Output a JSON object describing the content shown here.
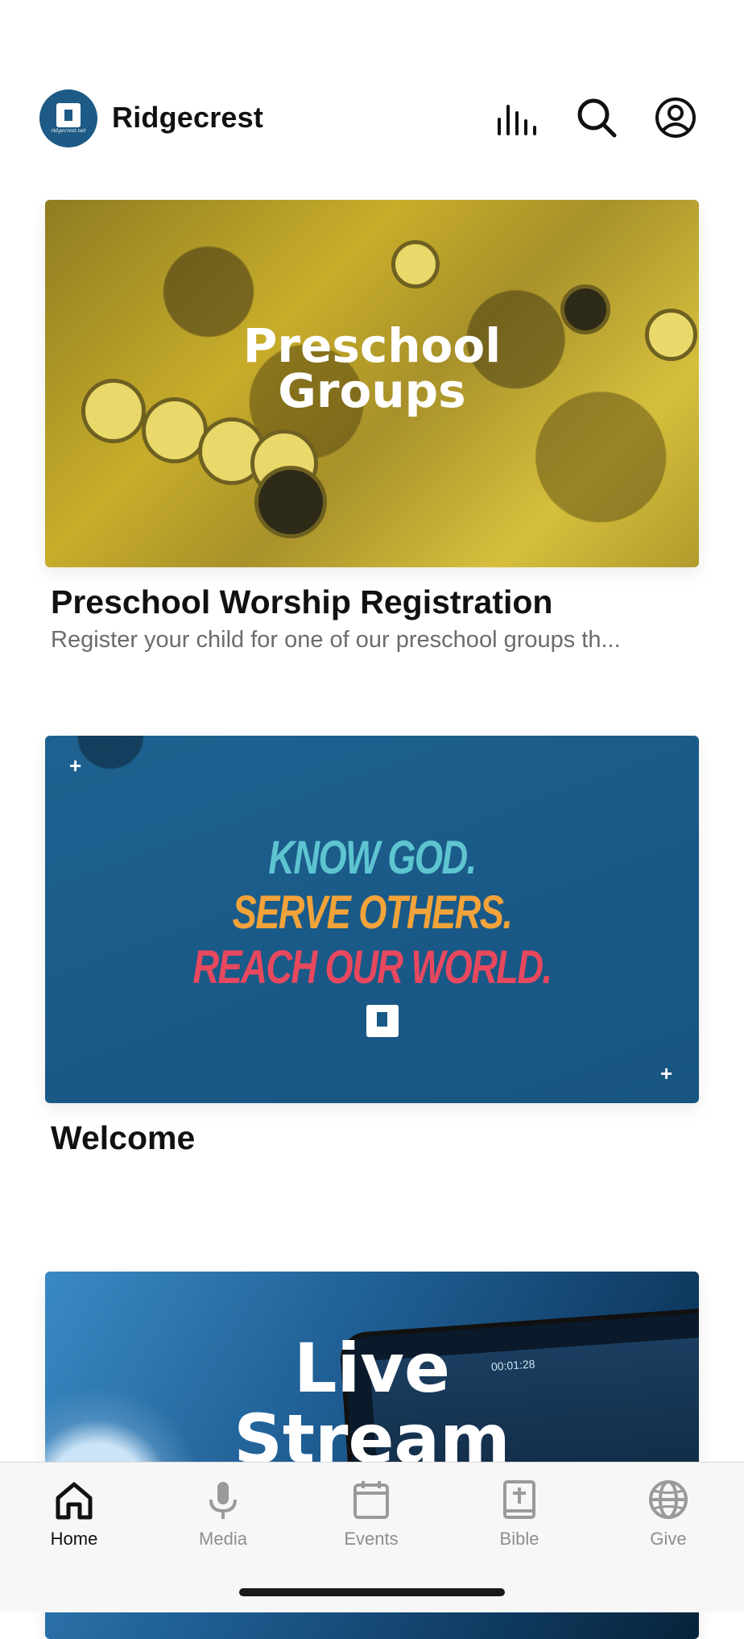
{
  "header": {
    "app_title": "Ridgecrest",
    "logo_text": "ridgecrest.net",
    "icons": [
      "audio-bars-icon",
      "search-icon",
      "profile-icon"
    ]
  },
  "cards": [
    {
      "image_caption_line1": "Preschool",
      "image_caption_line2": "Groups",
      "title": "Preschool Worship Registration",
      "subtitle": "Register your child for one of our preschool groups th..."
    },
    {
      "motto_line1": "KNOW GOD.",
      "motto_line2": "SERVE OTHERS.",
      "motto_line3": "REACH OUR WORLD.",
      "title": "Welcome"
    },
    {
      "image_caption_line1": "Live",
      "image_caption_line2": "Stream",
      "phone_time": "00:01:28"
    }
  ],
  "tabbar": {
    "tabs": [
      {
        "label": "Home",
        "icon": "home-icon",
        "active": true
      },
      {
        "label": "Media",
        "icon": "microphone-icon",
        "active": false
      },
      {
        "label": "Events",
        "icon": "calendar-icon",
        "active": false
      },
      {
        "label": "Bible",
        "icon": "bible-icon",
        "active": false
      },
      {
        "label": "Give",
        "icon": "globe-icon",
        "active": false
      }
    ]
  },
  "colors": {
    "brand_blue": "#1d5a86",
    "motto_teal": "#5ec4d0",
    "motto_orange": "#f2a33a",
    "motto_red": "#e8485e",
    "preschool_yellow": "#c8ad2a"
  }
}
